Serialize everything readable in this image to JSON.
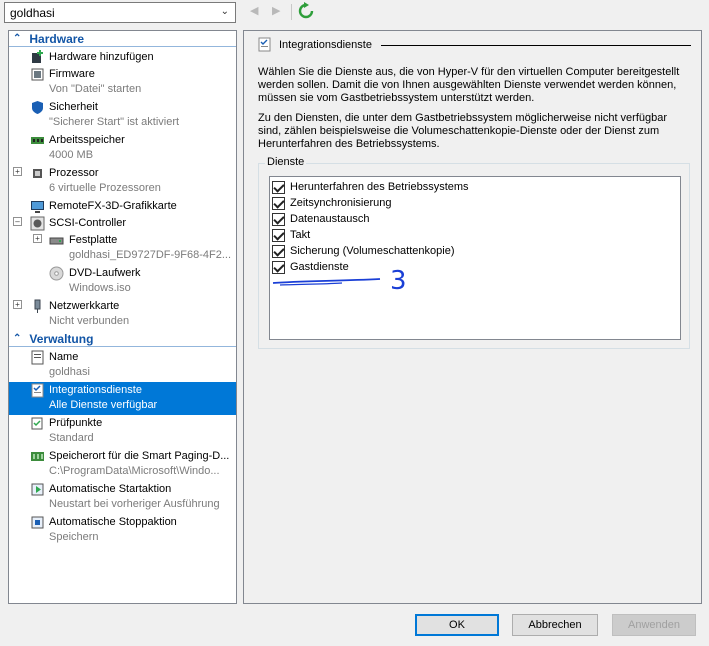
{
  "vm_selector": {
    "value": "goldhasi"
  },
  "hardware": {
    "header": "Hardware",
    "items": [
      {
        "label": "Hardware hinzufügen"
      },
      {
        "label": "Firmware",
        "sub": "Von \"Datei\" starten"
      },
      {
        "label": "Sicherheit",
        "sub": "\"Sicherer Start\" ist aktiviert"
      },
      {
        "label": "Arbeitsspeicher",
        "sub": "4000 MB"
      },
      {
        "label": "Prozessor",
        "sub": "6 virtuelle Prozessoren"
      },
      {
        "label": "RemoteFX-3D-Grafikkarte"
      },
      {
        "label": "SCSI-Controller"
      },
      {
        "label": "Festplatte",
        "sub": "goldhasi_ED9727DF-9F68-4F2..."
      },
      {
        "label": "DVD-Laufwerk",
        "sub": "Windows.iso"
      },
      {
        "label": "Netzwerkkarte",
        "sub": "Nicht verbunden"
      }
    ]
  },
  "management": {
    "header": "Verwaltung",
    "items": [
      {
        "label": "Name",
        "sub": "goldhasi"
      },
      {
        "label": "Integrationsdienste",
        "sub": "Alle Dienste verfügbar"
      },
      {
        "label": "Prüfpunkte",
        "sub": "Standard"
      },
      {
        "label": "Speicherort für die Smart Paging-D...",
        "sub": "C:\\ProgramData\\Microsoft\\Windo..."
      },
      {
        "label": "Automatische Startaktion",
        "sub": "Neustart bei vorheriger Ausführung"
      },
      {
        "label": "Automatische Stoppaktion",
        "sub": "Speichern"
      }
    ]
  },
  "detail": {
    "title": "Integrationsdienste",
    "para1": "Wählen Sie die Dienste aus, die von Hyper-V für den virtuellen Computer bereitgestellt werden sollen. Damit die von Ihnen ausgewählten Dienste verwendet werden können, müssen sie vom Gastbetriebssystem unterstützt werden.",
    "para2": "Zu den Diensten, die unter dem Gastbetriebssystem möglicherweise nicht verfügbar sind, zählen beispielsweise die Volumeschattenkopie-Dienste oder der Dienst zum Herunterfahren des Betriebssystems.",
    "group_label": "Dienste",
    "services": [
      {
        "label": "Herunterfahren des Betriebssystems",
        "checked": true
      },
      {
        "label": "Zeitsynchronisierung",
        "checked": true
      },
      {
        "label": "Datenaustausch",
        "checked": true
      },
      {
        "label": "Takt",
        "checked": true
      },
      {
        "label": "Sicherung (Volumeschattenkopie)",
        "checked": true
      },
      {
        "label": "Gastdienste",
        "checked": true
      }
    ],
    "annotation_mark": "3"
  },
  "buttons": {
    "ok": "OK",
    "cancel": "Abbrechen",
    "apply": "Anwenden"
  },
  "colors": {
    "selection": "#0078d7",
    "section_header": "#1255a6",
    "annotation": "#1a3fd6",
    "refresh": "#2e9e3a"
  }
}
